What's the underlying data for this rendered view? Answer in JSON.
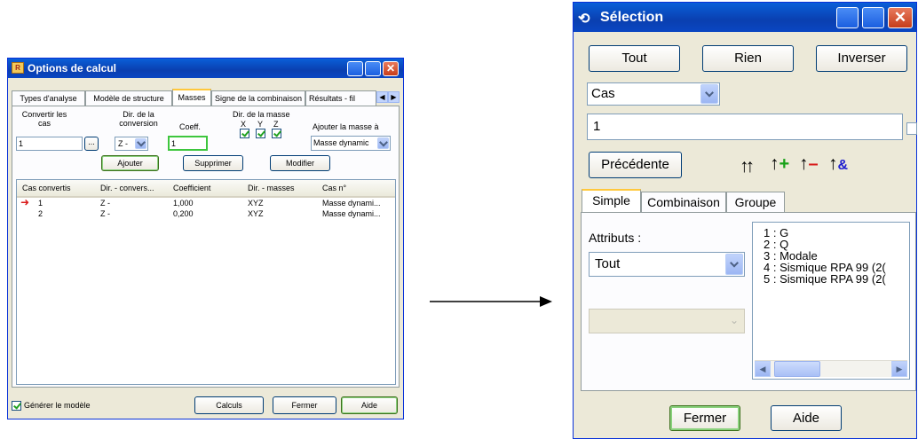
{
  "options_dialog": {
    "title": "Options de calcul",
    "tabs": [
      "Types d'analyse",
      "Modèle de structure",
      "Masses",
      "Signe de la combinaison",
      "Résultats - fil"
    ],
    "convert_cases_label": "Convertir les cas",
    "convert_cases_value": "1",
    "browse_label": "...",
    "conversion_dir_label": "Dir. de la conversion",
    "conversion_dir_value": "Z -",
    "coeff_label": "Coeff.",
    "coeff_value": "1",
    "mass_dir_label": "Dir. de la masse",
    "axis_x": "X",
    "axis_y": "Y",
    "axis_z": "Z",
    "add_mass_to_label": "Ajouter la masse à",
    "add_mass_to_value": "Masse dynamic",
    "add_button": "Ajouter",
    "delete_button": "Supprimer",
    "modify_button": "Modifier",
    "table_headers": [
      "Cas convertis",
      "Dir. - convers...",
      "Coefficient",
      "Dir. - masses",
      "Cas n°"
    ],
    "table_rows": [
      [
        "1",
        "Z -",
        "1,000",
        "XYZ",
        "Masse dynami..."
      ],
      [
        "2",
        "Z -",
        "0,200",
        "XYZ",
        "Masse dynami..."
      ]
    ],
    "generate_model_label": "Générer le modèle",
    "calc_button": "Calculs",
    "close_button": "Fermer",
    "help_button": "Aide"
  },
  "selection_dialog": {
    "title": "Sélection",
    "all_button": "Tout",
    "none_button": "Rien",
    "invert_button": "Inverser",
    "type_combo": "Cas",
    "selection_value": "1",
    "previous_button": "Précédente",
    "tabs": [
      "Simple",
      "Combinaison",
      "Groupe"
    ],
    "attributes_label": "Attributs :",
    "attributes_combo": "Tout",
    "case_list": [
      "1 : G",
      "2 : Q",
      "3 : Modale",
      "4 : Sismique RPA 99 (2(",
      "5 : Sismique RPA 99 (2("
    ],
    "close_button": "Fermer",
    "help_button": "Aide"
  }
}
